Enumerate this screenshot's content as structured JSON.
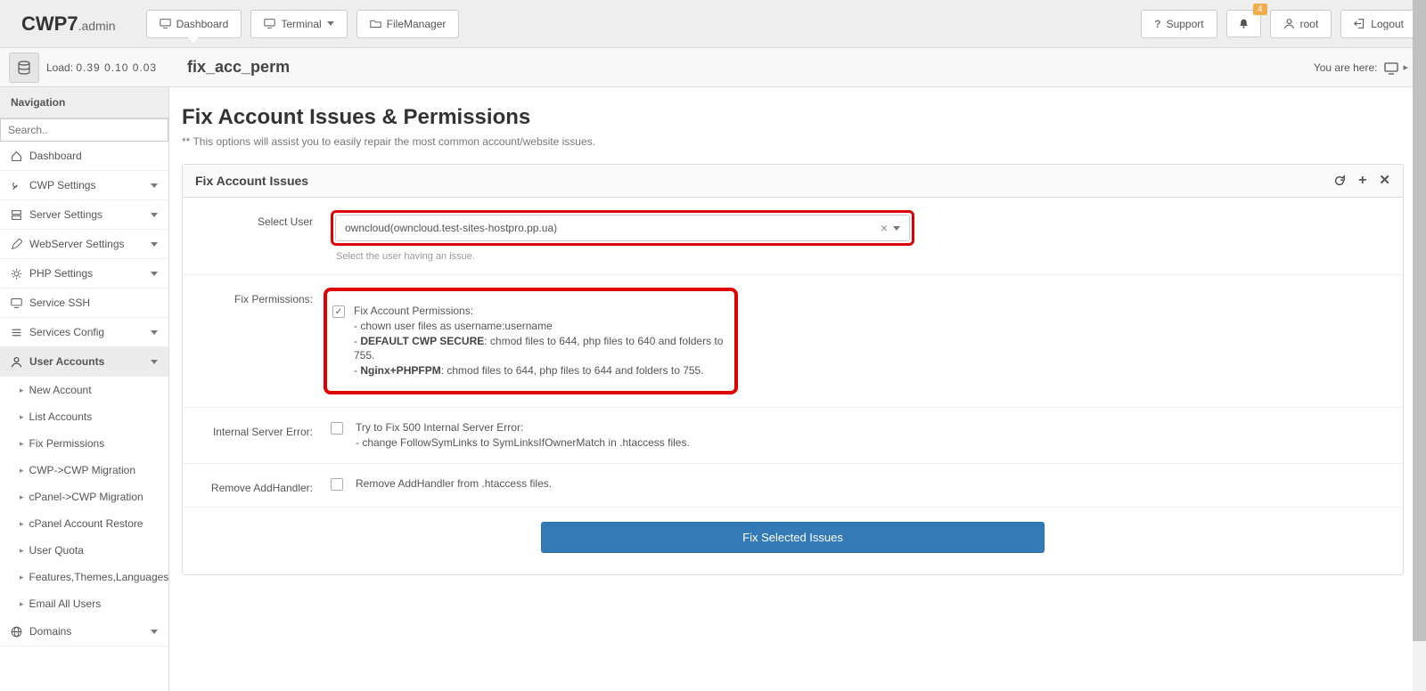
{
  "brand": {
    "main": "CWP7",
    "sub": ".admin"
  },
  "topbar": {
    "dashboard": "Dashboard",
    "terminal": "Terminal",
    "filemanager": "FileManager",
    "support": "Support",
    "root": "root",
    "logout": "Logout",
    "notif_count": "4"
  },
  "load": {
    "label": "Load:",
    "vals": "0.39  0.10  0.03"
  },
  "page": {
    "title": "fix_acc_perm",
    "breadcrumb_label": "You are here:"
  },
  "sidebar": {
    "header": "Navigation",
    "search_placeholder": "Search..",
    "items": [
      {
        "label": "Dashboard",
        "icon": "home"
      },
      {
        "label": "CWP Settings",
        "icon": "tools",
        "expandable": true
      },
      {
        "label": "Server Settings",
        "icon": "server",
        "expandable": true
      },
      {
        "label": "WebServer Settings",
        "icon": "edit",
        "expandable": true
      },
      {
        "label": "PHP Settings",
        "icon": "gear",
        "expandable": true
      },
      {
        "label": "Service SSH",
        "icon": "monitor"
      },
      {
        "label": "Services Config",
        "icon": "list",
        "expandable": true
      },
      {
        "label": "User Accounts",
        "icon": "user",
        "expandable": true,
        "active": true
      },
      {
        "label": "Domains",
        "icon": "globe",
        "expandable": true
      }
    ],
    "user_accounts_sub": [
      "New Account",
      "List Accounts",
      "Fix Permissions",
      "CWP->CWP Migration",
      "cPanel->CWP Migration",
      "cPanel Account Restore",
      "User Quota",
      "Features,Themes,Languages",
      "Email All Users"
    ]
  },
  "content": {
    "heading": "Fix Account Issues & Permissions",
    "subtitle": "** This options will assist you to easily repair the most common account/website issues.",
    "panel_title": "Fix Account Issues",
    "labels": {
      "select_user": "Select User",
      "fix_permissions": "Fix Permissions:",
      "internal_error": "Internal Server Error:",
      "remove_addhandler": "Remove AddHandler:"
    },
    "select_value": "owncloud(owncloud.test-sites-hostpro.pp.ua)",
    "select_help": "Select the user having an issue.",
    "perm_title": "Fix Account Permissions:",
    "perm_l1": "- chown user files as username:username",
    "perm_l2a": "- ",
    "perm_l2b": "DEFAULT CWP SECURE",
    "perm_l2c": ": chmod files to 644, php files to 640 and folders to 755.",
    "perm_l3a": "- ",
    "perm_l3b": "Nginx+PHPFPM",
    "perm_l3c": ": chmod files to 644, php files to 644 and folders to 755.",
    "err_l1": "Try to Fix 500 Internal Server Error:",
    "err_l2": "- change FollowSymLinks to SymLinksIfOwnerMatch in .htaccess files.",
    "remove_txt": "Remove AddHandler from .htaccess files.",
    "submit": "Fix Selected Issues"
  }
}
